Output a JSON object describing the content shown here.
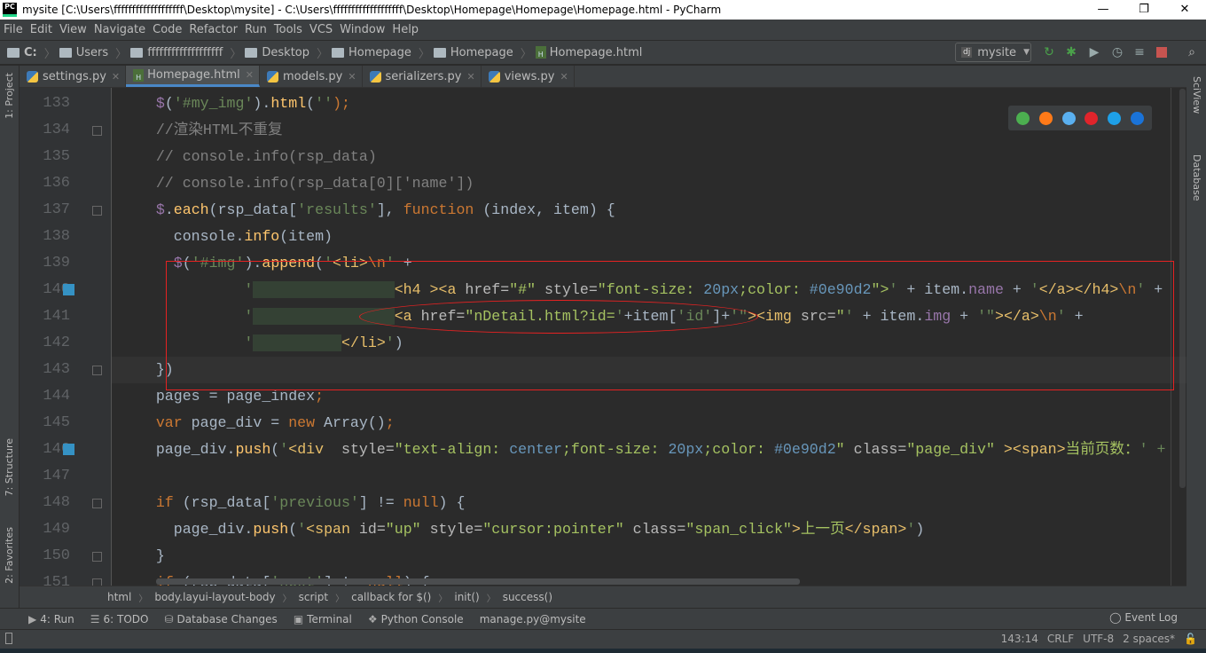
{
  "window": {
    "title": "mysite [C:\\Users\\fffffffffffffffffff\\Desktop\\mysite] - C:\\Users\\fffffffffffffffffff\\Desktop\\Homepage\\Homepage\\Homepage.html - PyCharm",
    "logo": "PC",
    "minimize": "—",
    "maximize": "❐",
    "close": "✕"
  },
  "menu": [
    "File",
    "Edit",
    "View",
    "Navigate",
    "Code",
    "Refactor",
    "Run",
    "Tools",
    "VCS",
    "Window",
    "Help"
  ],
  "breadcrumb": [
    "C:",
    "Users",
    "fffffffffffffffffff",
    "Desktop",
    "Homepage",
    "Homepage",
    "Homepage.html"
  ],
  "run_config": {
    "label": "mysite",
    "icon": "django-icon"
  },
  "tabs": [
    {
      "label": "settings.py",
      "icon": "python-file-icon",
      "active": false
    },
    {
      "label": "Homepage.html",
      "icon": "html-file-icon",
      "active": true
    },
    {
      "label": "models.py",
      "icon": "python-file-icon",
      "active": false
    },
    {
      "label": "serializers.py",
      "icon": "python-file-icon",
      "active": false
    },
    {
      "label": "views.py",
      "icon": "python-file-icon",
      "active": false
    }
  ],
  "left_tools": [
    "1: Project",
    "7: Structure",
    "2: Favorites"
  ],
  "right_tools": [
    "SciView",
    "Database"
  ],
  "browsers": [
    {
      "name": "chrome",
      "color": "#4caf50"
    },
    {
      "name": "firefox",
      "color": "#ff7a18"
    },
    {
      "name": "safari",
      "color": "#5ab0f0"
    },
    {
      "name": "opera",
      "color": "#e0242b"
    },
    {
      "name": "ie",
      "color": "#1ea0e8"
    },
    {
      "name": "edge",
      "color": "#1a73d8"
    }
  ],
  "code": {
    "current_line": 143,
    "lines": [
      {
        "n": 133,
        "tokens": [
          [
            "    ",
            ""
          ],
          [
            "$",
            "p"
          ],
          [
            "(",
            ""
          ],
          [
            "'#my_img'",
            "s"
          ],
          [
            ").",
            ""
          ],
          [
            "html",
            "f"
          ],
          [
            "(",
            ""
          ],
          [
            "''",
            "s"
          ],
          [
            ");",
            "k"
          ]
        ]
      },
      {
        "n": 134,
        "tokens": [
          [
            "    //渲染HTML不重复",
            "c"
          ]
        ]
      },
      {
        "n": 135,
        "tokens": [
          [
            "    // console.info(rsp_data)",
            "c"
          ]
        ]
      },
      {
        "n": 136,
        "tokens": [
          [
            "    // console.info(rsp_data[0]['name'])",
            "c"
          ]
        ]
      },
      {
        "n": 137,
        "tokens": [
          [
            "    ",
            ""
          ],
          [
            "$",
            "p"
          ],
          [
            ".",
            ""
          ],
          [
            "each",
            "f"
          ],
          [
            "(rsp_data[",
            ""
          ],
          [
            "'results'",
            "s"
          ],
          [
            "], ",
            ""
          ],
          [
            "function",
            "k"
          ],
          [
            " (index, item) {",
            ""
          ]
        ]
      },
      {
        "n": 138,
        "tokens": [
          [
            "      console.",
            ""
          ],
          [
            "info",
            "f"
          ],
          [
            "(item)",
            ""
          ]
        ]
      },
      {
        "n": 139,
        "tokens": [
          [
            "      ",
            ""
          ],
          [
            "$",
            "p"
          ],
          [
            "(",
            ""
          ],
          [
            "'#img'",
            "s"
          ],
          [
            ").",
            ""
          ],
          [
            "append",
            "f"
          ],
          [
            "(",
            ""
          ],
          [
            "'",
            "s"
          ],
          [
            "<li>",
            "t"
          ],
          [
            "\\n",
            "k"
          ],
          [
            "'",
            "s"
          ],
          [
            " +",
            ""
          ]
        ]
      },
      {
        "n": 140,
        "tokens": [
          [
            "              ",
            ""
          ],
          [
            "'",
            "s"
          ],
          [
            "                ",
            "hl"
          ],
          [
            "<h4 ><a ",
            "t"
          ],
          [
            "href=",
            "a"
          ],
          [
            "\"#\" ",
            "v"
          ],
          [
            "style=",
            "a"
          ],
          [
            "\"font-size: ",
            "v"
          ],
          [
            "20px",
            "n"
          ],
          [
            ";color: ",
            "v"
          ],
          [
            "#0e90d2",
            "n"
          ],
          [
            "\">",
            "v"
          ],
          [
            "'",
            "s"
          ],
          [
            " + item.",
            ""
          ],
          [
            "name",
            "p"
          ],
          [
            " + ",
            ""
          ],
          [
            "'",
            "s"
          ],
          [
            "</a></h4>",
            "t"
          ],
          [
            "\\n",
            "k"
          ],
          [
            "'",
            "s"
          ],
          [
            " +",
            ""
          ]
        ]
      },
      {
        "n": 141,
        "tokens": [
          [
            "              ",
            ""
          ],
          [
            "'",
            "s"
          ],
          [
            "                ",
            "hl"
          ],
          [
            "<a ",
            "t"
          ],
          [
            "href=",
            "a"
          ],
          [
            "\"nDetail.html?id=",
            "v"
          ],
          [
            "'",
            "s"
          ],
          [
            "+item[",
            ""
          ],
          [
            "'id'",
            "s"
          ],
          [
            "]+",
            ""
          ],
          [
            "'\"",
            "s"
          ],
          [
            ">",
            "t"
          ],
          [
            "<img",
            "t"
          ],
          [
            " src=",
            "a"
          ],
          [
            "\"",
            "v"
          ],
          [
            "'",
            "s"
          ],
          [
            " + item.",
            ""
          ],
          [
            "img",
            "p"
          ],
          [
            " + ",
            ""
          ],
          [
            "'\"",
            "s"
          ],
          [
            "></a>",
            "t"
          ],
          [
            "\\n",
            "k"
          ],
          [
            "'",
            "s"
          ],
          [
            " +",
            ""
          ]
        ]
      },
      {
        "n": 142,
        "tokens": [
          [
            "              ",
            ""
          ],
          [
            "'",
            "s"
          ],
          [
            "          ",
            "hl"
          ],
          [
            "</li>",
            "t"
          ],
          [
            "'",
            "s"
          ],
          [
            ")",
            ""
          ]
        ]
      },
      {
        "n": 143,
        "tokens": [
          [
            "    })",
            ""
          ]
        ]
      },
      {
        "n": 144,
        "tokens": [
          [
            "    pages = page_index",
            ""
          ],
          [
            ";",
            "k"
          ]
        ]
      },
      {
        "n": 145,
        "tokens": [
          [
            "    ",
            ""
          ],
          [
            "var",
            "k"
          ],
          [
            " page_div = ",
            ""
          ],
          [
            "new",
            "k"
          ],
          [
            " Array()",
            ""
          ],
          [
            ";",
            "k"
          ]
        ]
      },
      {
        "n": 146,
        "tokens": [
          [
            "    page_div.",
            ""
          ],
          [
            "push",
            "f"
          ],
          [
            "(",
            ""
          ],
          [
            "'",
            "s"
          ],
          [
            "<div  ",
            "t"
          ],
          [
            "style=",
            "a"
          ],
          [
            "\"text-align: ",
            "v"
          ],
          [
            "center",
            "n"
          ],
          [
            ";font-size: ",
            "v"
          ],
          [
            "20px",
            "n"
          ],
          [
            ";color: ",
            "v"
          ],
          [
            "#0e90d2",
            "n"
          ],
          [
            "\" ",
            "v"
          ],
          [
            "class=",
            "a"
          ],
          [
            "\"page_div\" ",
            "v"
          ],
          [
            "><span>",
            "t"
          ],
          [
            "当前页数：",
            "v"
          ],
          [
            "' +",
            "s"
          ]
        ]
      },
      {
        "n": 147,
        "tokens": []
      },
      {
        "n": 148,
        "tokens": [
          [
            "    ",
            ""
          ],
          [
            "if",
            "k"
          ],
          [
            " (rsp_data[",
            ""
          ],
          [
            "'previous'",
            "s"
          ],
          [
            "] != ",
            ""
          ],
          [
            "null",
            "k"
          ],
          [
            ") {",
            ""
          ]
        ]
      },
      {
        "n": 149,
        "tokens": [
          [
            "      page_div.",
            ""
          ],
          [
            "push",
            "f"
          ],
          [
            "(",
            ""
          ],
          [
            "'",
            "s"
          ],
          [
            "<span ",
            "t"
          ],
          [
            "id=",
            "a"
          ],
          [
            "\"up\" ",
            "v"
          ],
          [
            "style=",
            "a"
          ],
          [
            "\"cursor:pointer\" ",
            "v"
          ],
          [
            "class=",
            "a"
          ],
          [
            "\"span_click\"",
            "v"
          ],
          [
            ">",
            "t"
          ],
          [
            "上一页",
            "v"
          ],
          [
            "</span>",
            "t"
          ],
          [
            "'",
            "s"
          ],
          [
            ")",
            ""
          ]
        ]
      },
      {
        "n": 150,
        "tokens": [
          [
            "    }",
            ""
          ]
        ]
      },
      {
        "n": 151,
        "tokens": [
          [
            "    ",
            ""
          ],
          [
            "if",
            "k"
          ],
          [
            " (rsp_data[",
            ""
          ],
          [
            "'next'",
            "s"
          ],
          [
            "] != ",
            ""
          ],
          [
            "null",
            "k"
          ],
          [
            ") {",
            ""
          ]
        ]
      }
    ]
  },
  "code_breadcrumb": [
    "html",
    "body.layui-layout-body",
    "script",
    "callback for $()",
    "init()",
    "success()"
  ],
  "tool_windows": [
    {
      "label": "4: Run",
      "icon": "run-icon"
    },
    {
      "label": "6: TODO",
      "icon": "todo-icon"
    },
    {
      "label": "Database Changes",
      "icon": "database-icon"
    },
    {
      "label": "Terminal",
      "icon": "terminal-icon"
    },
    {
      "label": "Python Console",
      "icon": "python-console-icon"
    },
    {
      "label": "manage.py@mysite",
      "icon": ""
    }
  ],
  "event_log": "Event Log",
  "status": {
    "position": "143:14",
    "line_sep": "CRLF",
    "encoding": "UTF-8",
    "indent": "2 spaces*"
  },
  "annotation_color": "#e52222"
}
